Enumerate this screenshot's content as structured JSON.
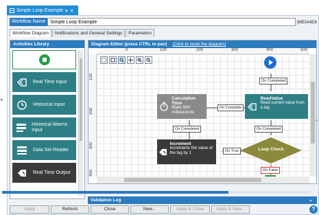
{
  "window": {
    "tab_title": "Simple Loop Example",
    "pin_glyph": "▾",
    "close_glyph": "✕"
  },
  "workflow": {
    "name_label": "Workflow Name",
    "name_value": "Simple Loop Example",
    "id_text": "[MEIA4E6"
  },
  "tabs": [
    {
      "label": "Workflow Diagram",
      "active": true
    },
    {
      "label": "Notifications and General Settings",
      "active": false
    },
    {
      "label": "Parameters",
      "active": false
    }
  ],
  "library": {
    "title": "Activities Library",
    "items": [
      {
        "label": "Real Time Input",
        "icon": "tag-arrow-icon",
        "style": "teal"
      },
      {
        "label": "Historical Input",
        "icon": "history-icon",
        "style": "teal"
      },
      {
        "label": "Historical Alarms Input",
        "icon": "alarm-list-icon",
        "style": "teal"
      },
      {
        "label": "Data Set Reader",
        "icon": "dataset-icon",
        "style": "teal"
      },
      {
        "label": "Real Time Output",
        "icon": "tag-out-icon",
        "style": "dark"
      }
    ]
  },
  "editor": {
    "title": "Diagram Editor (press CTRL to pan)",
    "reset_link": "(Click to reset the diagram)",
    "ruler_top": [
      "0",
      "100",
      "200",
      "300",
      "400",
      "500"
    ],
    "ruler_left": [
      "100",
      "200",
      "300",
      "400"
    ],
    "nodes": {
      "calc": {
        "title": "Calculation Time",
        "desc": "Waits 500 milliseconds"
      },
      "read": {
        "title": "ReadValue",
        "desc": "Read current value from a tag"
      },
      "incr": {
        "title": "Increment",
        "desc": "Increments the value of the tag by 1"
      },
      "check": {
        "title": "Loop Check"
      }
    },
    "labels": {
      "on_completed_top": "On Completed",
      "on_complete_mid": "On Complete",
      "on_completed_calc": "On Completed",
      "on_completed_read": "On Completed",
      "on_true": "On True",
      "on_false": "On False"
    }
  },
  "validation": {
    "title": "Validation Log",
    "chevron": "⌄"
  },
  "buttons": [
    {
      "label": "Apply",
      "enabled": false
    },
    {
      "label": "Refresh",
      "enabled": true
    },
    {
      "label": "Close",
      "enabled": true
    },
    {
      "label": "New...",
      "enabled": true
    },
    {
      "label": "Apply & Close",
      "enabled": false
    },
    {
      "label": "Apply & New...",
      "enabled": false
    }
  ],
  "help_glyph": "?",
  "left_arrow": "▸",
  "right_handle": "⇔",
  "colors": {
    "accent": "#2b7bbf",
    "teal": "#2e7e85",
    "dark": "#3a3a3a",
    "green": "#2a9d4b"
  }
}
